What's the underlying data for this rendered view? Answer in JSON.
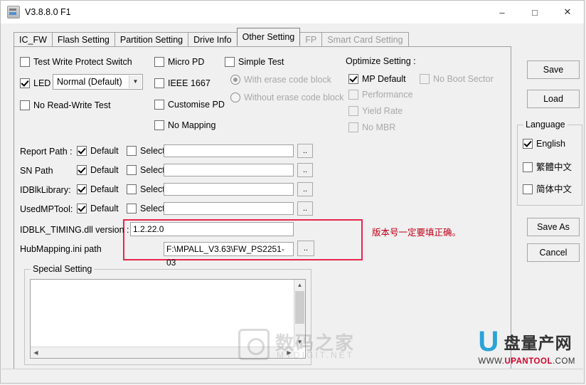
{
  "window": {
    "title": "V3.8.8.0 F1",
    "icon": "app-icon",
    "buttons": {
      "minimize": "–",
      "maximize": "□",
      "close": "✕"
    }
  },
  "tabs": [
    {
      "label": "IC_FW",
      "selected": false,
      "disabled": false
    },
    {
      "label": "Flash Setting",
      "selected": false,
      "disabled": false
    },
    {
      "label": "Partition Setting",
      "selected": false,
      "disabled": false
    },
    {
      "label": "Drive Info",
      "selected": false,
      "disabled": false
    },
    {
      "label": "Other Setting",
      "selected": true,
      "disabled": false
    },
    {
      "label": "FP",
      "selected": false,
      "disabled": true
    },
    {
      "label": "Smart Card Setting",
      "selected": false,
      "disabled": true
    }
  ],
  "checks": {
    "test_write_protect_switch": {
      "label": "Test Write Protect Switch",
      "checked": false
    },
    "led": {
      "label": "LED",
      "checked": true
    },
    "no_read_write_test": {
      "label": "No Read-Write Test",
      "checked": false
    },
    "micro_pd": {
      "label": "Micro PD",
      "checked": false
    },
    "ieee_1667": {
      "label": "IEEE 1667",
      "checked": false
    },
    "customise_pd": {
      "label": "Customise PD",
      "checked": false
    },
    "no_mapping": {
      "label": "No Mapping",
      "checked": false
    },
    "simple_test": {
      "label": "Simple Test",
      "checked": false
    }
  },
  "led_select": {
    "value": "Normal (Default)"
  },
  "simple_test_radios": [
    {
      "label": "With erase code block",
      "selected": true
    },
    {
      "label": "Without erase code block",
      "selected": false
    }
  ],
  "optimize": {
    "title": "Optimize Setting :",
    "items": [
      {
        "label": "MP Default",
        "checked": true,
        "disabled": false
      },
      {
        "label": "No Boot Sector",
        "checked": false,
        "disabled": true
      },
      {
        "label": "Performance",
        "checked": false,
        "disabled": true
      },
      {
        "label": "Yield Rate",
        "checked": false,
        "disabled": true
      },
      {
        "label": "No MBR",
        "checked": false,
        "disabled": true
      }
    ]
  },
  "paths": [
    {
      "name": "Report Path :",
      "default_label": "Default",
      "default_checked": true,
      "select_label": "Select",
      "select_checked": false,
      "value": "",
      "browse": ".."
    },
    {
      "name": "SN Path",
      "default_label": "Default",
      "default_checked": true,
      "select_label": "Select",
      "select_checked": false,
      "value": "",
      "browse": ".."
    },
    {
      "name": "IDBlkLibrary:",
      "default_label": "Default",
      "default_checked": true,
      "select_label": "Select",
      "select_checked": false,
      "value": "",
      "browse": ".."
    },
    {
      "name": "UsedMPTool:",
      "default_label": "Default",
      "default_checked": true,
      "select_label": "Select",
      "select_checked": false,
      "value": "",
      "browse": ".."
    }
  ],
  "idblk_timing": {
    "label": "IDBLK_TIMING.dll version :",
    "value": "1.2.22.0"
  },
  "hubmapping": {
    "label": "HubMapping.ini path",
    "value": "F:\\MPALL_V3.63\\FW_PS2251-03",
    "browse": ".."
  },
  "note": "版本号一定要填正确。",
  "special_setting": {
    "title": "Special Setting",
    "value": ""
  },
  "right_buttons": [
    {
      "label": "Save",
      "name": "save-button"
    },
    {
      "label": "Load",
      "name": "load-button"
    },
    {
      "label": "Save As",
      "name": "save-as-button"
    },
    {
      "label": "Cancel",
      "name": "cancel-button"
    }
  ],
  "language": {
    "title": "Language",
    "items": [
      {
        "label": "English",
        "checked": true
      },
      {
        "label": "繁體中文",
        "checked": false
      },
      {
        "label": "简体中文",
        "checked": false
      }
    ]
  },
  "watermark": {
    "center_title": "数码之家",
    "center_sub": "MYDIGIT.NET",
    "brand_u": "U",
    "brand_cn": "盘量产网",
    "brand_url_prefix": "WWW.",
    "brand_url_main": "UPANTOOL",
    "brand_url_suffix": ".COM"
  },
  "status_strip": ""
}
